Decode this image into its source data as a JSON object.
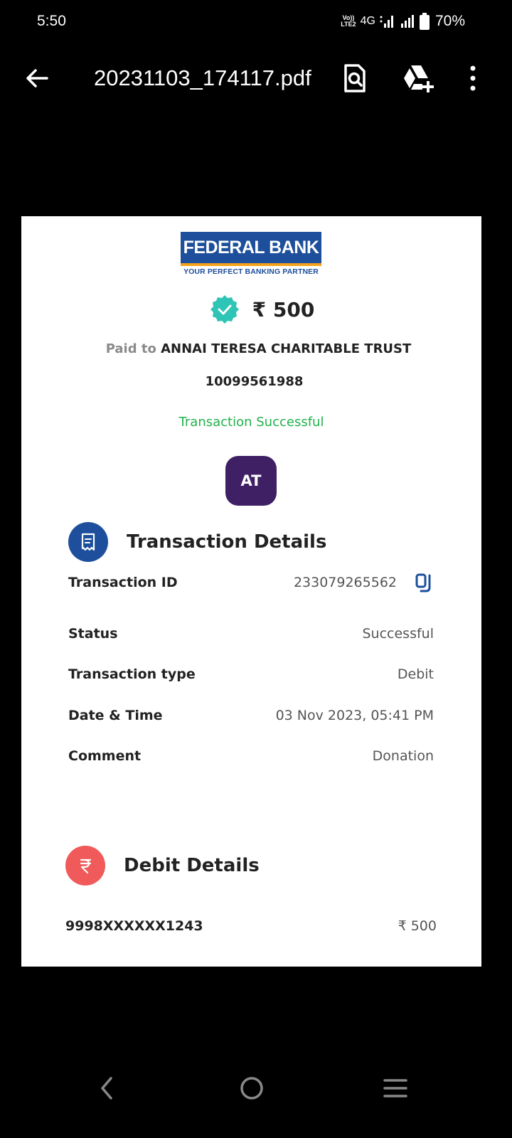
{
  "status_bar": {
    "time": "5:50",
    "volte_top": "Vo))",
    "volte_bottom": "LTE2",
    "network": "4G",
    "battery": "70%"
  },
  "app_bar": {
    "file_name": "20231103_174117.pdf",
    "back_icon": "arrow-back-icon",
    "search_icon": "document-search-icon",
    "drive_icon": "add-to-drive-icon",
    "more_icon": "more-vert-icon"
  },
  "receipt": {
    "bank_name": "FEDERAL BANK",
    "bank_tagline": "YOUR PERFECT BANKING PARTNER",
    "amount": "₹ 500",
    "paid_to_prefix": "Paid to",
    "payee": "ANNAI TERESA CHARITABLE TRUST",
    "payee_account": "10099561988",
    "status_message": "Transaction Successful",
    "avatar_initials": "AT",
    "transaction_section": {
      "title": "Transaction Details",
      "rows": [
        {
          "label": "Transaction ID",
          "value": "233079265562"
        },
        {
          "label": "Status",
          "value": "Successful"
        },
        {
          "label": "Transaction type",
          "value": "Debit"
        },
        {
          "label": "Date & Time",
          "value": "03 Nov 2023, 05:41 PM"
        },
        {
          "label": "Comment",
          "value": "Donation"
        }
      ]
    },
    "debit_section": {
      "title": "Debit Details",
      "account": "9998XXXXXX1243",
      "amount": "₹ 500"
    }
  },
  "colors": {
    "bank_blue": "#1d4f9c",
    "success_green": "#22b14c",
    "check_teal": "#2ec4b6",
    "avatar_purple": "#3f2064",
    "debit_red": "#f05a5a"
  }
}
